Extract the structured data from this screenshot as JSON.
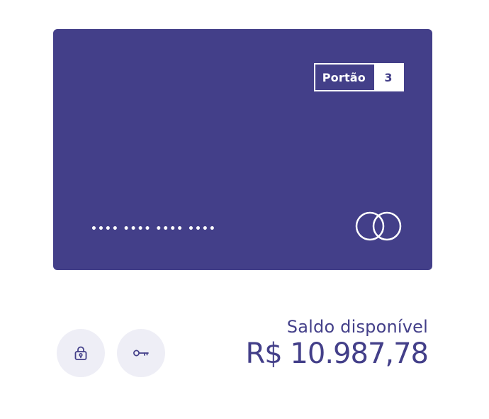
{
  "card": {
    "badge_label": "Portão",
    "badge_number": "3",
    "number_masked": "•••• •••• •••• ••••",
    "brand_icon": "mastercard-outline-icon",
    "background_color": "#433f89"
  },
  "actions": [
    {
      "icon": "lock-icon"
    },
    {
      "icon": "key-icon"
    }
  ],
  "balance": {
    "label": "Saldo disponível",
    "value": "R$ 10.987,78"
  },
  "colors": {
    "accent": "#433f89",
    "button_bg": "#eeeef6",
    "text_on_card": "#ffffff"
  }
}
